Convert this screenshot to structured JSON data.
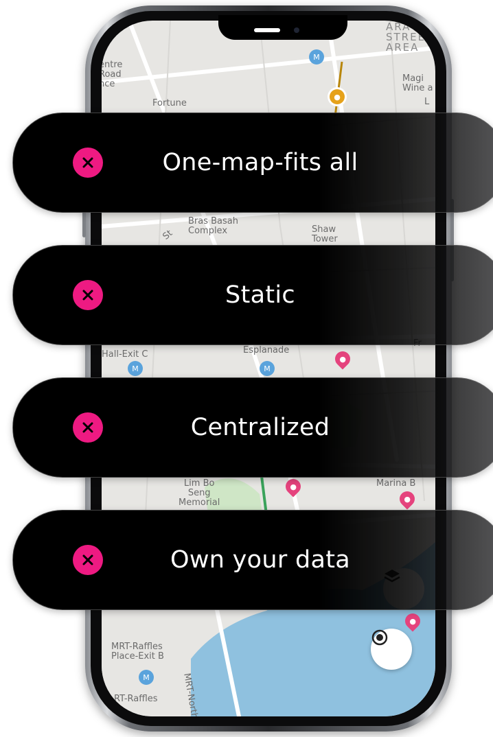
{
  "map": {
    "labels": {
      "centre_road_nce": "entre\nRoad\nnce",
      "fortune": "Fortune",
      "arab_street_area": "ARA\nSTREE\nAREA",
      "magi_wine": "Magi\nWine a",
      "l_edge": "L",
      "bras_basah_complex": "Bras Basah\nComplex",
      "shaw_tower": "Shaw\nTower",
      "st_road": "St",
      "hall_exit_c": "Hall-Exit C",
      "esplanade": "Esplanade",
      "fr_edge": "Fr",
      "lim_bo_seng_memorial": "Lim Bo\nSeng\nMemorial",
      "marina_b": "Marina B",
      "mrt_raffles_place_exit_b": "MRT-Raffles\nPlace-Exit B",
      "mrt_north_s": "MRT-North S",
      "mrt_raffles_bottom": "RT-Raffles"
    }
  },
  "features": [
    {
      "label": "One-map-fits all",
      "icon": "close-icon"
    },
    {
      "label": "Static",
      "icon": "close-icon"
    },
    {
      "label": "Centralized",
      "icon": "close-icon"
    },
    {
      "label": "Own your data",
      "icon": "close-icon"
    }
  ],
  "colors": {
    "accent_pink": "#ee1a82",
    "pill_bg": "#000000",
    "map_bg": "#e7e6e3",
    "water": "#8fc1df",
    "park": "#cfe6c6"
  },
  "icons": {
    "locate": "locate-icon",
    "layers": "layers-icon",
    "metro": "metro-icon",
    "shop": "shopping-bag-icon",
    "food": "food-icon"
  }
}
